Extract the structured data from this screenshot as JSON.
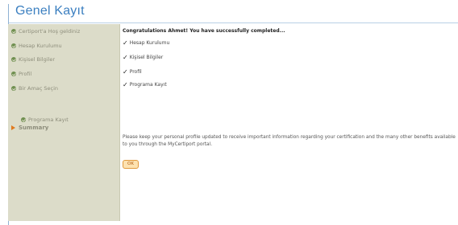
{
  "header": {
    "title": "Genel Kayıt"
  },
  "sidebar": {
    "items": [
      {
        "label": "Certiport'a Hoş geldiniz"
      },
      {
        "label": "Hesap Kurulumu"
      },
      {
        "label": "Kişisel Bilgiler"
      },
      {
        "label": "Profil"
      },
      {
        "label": "Bir Amaç Seçin"
      },
      {
        "label": "Programa Kayıt"
      }
    ],
    "current": "Summary"
  },
  "main": {
    "heading": "Congratulations Ahmet! You have successfully completed...",
    "completed": [
      {
        "label": "Hesap Kurulumu"
      },
      {
        "label": "Kişisel Bilgiler"
      },
      {
        "label": "Profil"
      },
      {
        "label": "Programa Kayıt"
      }
    ],
    "paragraph": "Please keep your personal profile updated to receive important information regarding your certification and the many other benefits available to you through the MyCertiport portal.",
    "ok_label": "OK"
  },
  "colors": {
    "title": "#3b7fc0",
    "sidebar_bg": "#dcdcc9",
    "accent": "#e07a1e"
  }
}
